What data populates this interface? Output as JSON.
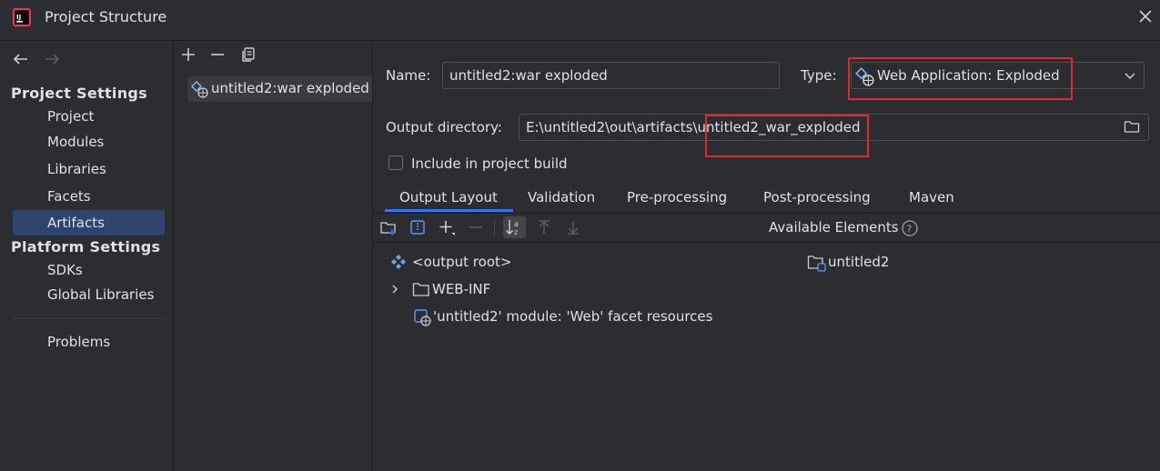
{
  "window": {
    "title": "Project Structure"
  },
  "sidebar": {
    "project_settings_title": "Project Settings",
    "platform_settings_title": "Platform Settings",
    "items": [
      {
        "label": "Project"
      },
      {
        "label": "Modules"
      },
      {
        "label": "Libraries"
      },
      {
        "label": "Facets"
      },
      {
        "label": "Artifacts",
        "selected": true
      },
      {
        "label": "SDKs"
      },
      {
        "label": "Global Libraries"
      },
      {
        "label": "Problems"
      }
    ]
  },
  "artifacts_list": {
    "items": [
      {
        "label": "untitled2:war exploded"
      }
    ]
  },
  "form": {
    "name_label": "Name:",
    "name_value": "untitled2:war exploded",
    "type_label": "Type:",
    "type_value": "Web Application: Exploded",
    "output_label": "Output directory:",
    "output_value": "E:\\untitled2\\out\\artifacts\\untitled2_war_exploded",
    "include_label": "Include in project build"
  },
  "tabs": [
    {
      "label": "Output Layout",
      "active": true
    },
    {
      "label": "Validation"
    },
    {
      "label": "Pre-processing"
    },
    {
      "label": "Post-processing"
    },
    {
      "label": "Maven"
    }
  ],
  "layout_tree": {
    "root": "<output root>",
    "children": [
      {
        "label": "WEB-INF"
      },
      {
        "label": "'untitled2' module: 'Web' facet resources"
      }
    ]
  },
  "available": {
    "title": "Available Elements",
    "items": [
      {
        "label": "untitled2"
      }
    ]
  },
  "colors": {
    "accent": "#3574f0",
    "selection": "#2e436e",
    "highlight": "#e0292c"
  }
}
